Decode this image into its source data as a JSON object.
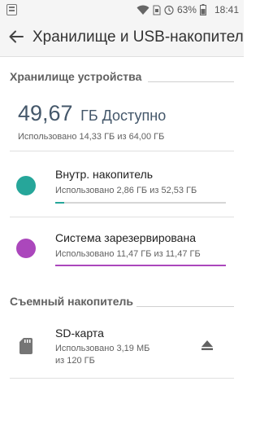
{
  "status_bar": {
    "battery_percent": "63%",
    "time": "18:41"
  },
  "app_bar": {
    "title": "Хранилище и USB-накопитель"
  },
  "device_storage": {
    "header": "Хранилище устройства",
    "available_value": "49,67",
    "available_unit": "ГБ Доступно",
    "used_summary": "Использовано 14,33 ГБ из 64,00 ГБ"
  },
  "volumes": [
    {
      "name": "Внутр. накопитель",
      "used": "Использовано 2,86 ГБ из 52,53 ГБ",
      "fraction": 0.054,
      "color": "#26a69a"
    },
    {
      "name": "Система зарезервирована",
      "used": "Использовано 11,47 ГБ из 11,47 ГБ",
      "fraction": 1.0,
      "color": "#ab47bc"
    }
  ],
  "removable_storage": {
    "header": "Съемный накопитель",
    "sd_name": "SD-карта",
    "sd_used_line1": "Использовано 3,19 МБ",
    "sd_used_line2": "из 120 ГБ"
  }
}
